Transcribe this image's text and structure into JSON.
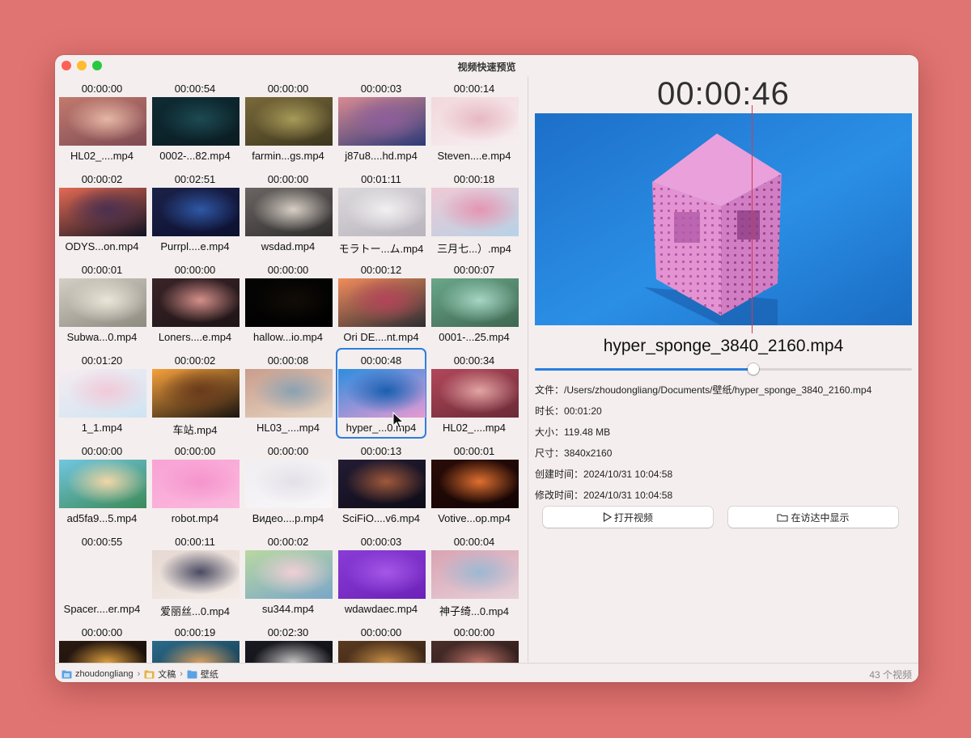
{
  "window": {
    "title": "视频快速预览"
  },
  "videos": [
    {
      "time": "00:00:00",
      "name": "HL02_....mp4",
      "thumb": [
        "#c27a6e",
        "#e6b7a5",
        "#7d4a52"
      ]
    },
    {
      "time": "00:00:54",
      "name": "0002-...82.mp4",
      "thumb": [
        "#0f2b34",
        "#1d4a52",
        "#0a1c22"
      ]
    },
    {
      "time": "00:00:00",
      "name": "farmin...gs.mp4",
      "thumb": [
        "#7a6a3a",
        "#a89a58",
        "#3d361e"
      ]
    },
    {
      "time": "00:00:03",
      "name": "j87u8....hd.mp4",
      "thumb": [
        "#d98a92",
        "#8d5e9c",
        "#2c3a78"
      ]
    },
    {
      "time": "00:00:14",
      "name": "Steven....e.mp4",
      "thumb": [
        "#f2d8dd",
        "#e7b8c2",
        "#f7eef0"
      ]
    },
    {
      "time": "00:00:02",
      "name": "ODYS...on.mp4",
      "thumb": [
        "#e36a54",
        "#4a3050",
        "#101322"
      ]
    },
    {
      "time": "00:02:51",
      "name": "Purrpl....e.mp4",
      "thumb": [
        "#1b2148",
        "#2f58a6",
        "#0c1030"
      ]
    },
    {
      "time": "00:00:00",
      "name": "wsdad.mp4",
      "thumb": [
        "#6b6664",
        "#d8d0c6",
        "#2e2c2c"
      ]
    },
    {
      "time": "00:01:11",
      "name": "モラトー...ム.mp4",
      "thumb": [
        "#dbd8dc",
        "#f3f0f2",
        "#b9b4bd"
      ]
    },
    {
      "time": "00:00:18",
      "name": "三月七...）.mp4",
      "thumb": [
        "#f0c9d4",
        "#e595b1",
        "#b6d2e6"
      ]
    },
    {
      "time": "00:00:01",
      "name": "Subwa...0.mp4",
      "thumb": [
        "#d3cfc4",
        "#ebe6d9",
        "#8d8a80"
      ]
    },
    {
      "time": "00:00:00",
      "name": "Loners....e.mp4",
      "thumb": [
        "#3a2428",
        "#d5908a",
        "#1e1416"
      ]
    },
    {
      "time": "00:00:00",
      "name": "hallow...io.mp4",
      "thumb": [
        "#050505",
        "#120c06",
        "#000000"
      ]
    },
    {
      "time": "00:00:12",
      "name": "Ori DE....nt.mp4",
      "thumb": [
        "#f28c5c",
        "#b3435a",
        "#2c2d33"
      ]
    },
    {
      "time": "00:00:07",
      "name": "0001-...25.mp4",
      "thumb": [
        "#6aa78a",
        "#a6d6c4",
        "#3e6650"
      ]
    },
    {
      "time": "00:01:20",
      "name": "1_1.mp4",
      "thumb": [
        "#f6ecf1",
        "#f2c9d8",
        "#cfe4f2"
      ]
    },
    {
      "time": "00:00:02",
      "name": "车站.mp4",
      "thumb": [
        "#f6a13c",
        "#6a3a1c",
        "#1a1410"
      ]
    },
    {
      "time": "00:00:08",
      "name": "HL03_....mp4",
      "thumb": [
        "#c99d8c",
        "#8aa1b2",
        "#e7d6c4"
      ]
    },
    {
      "time": "00:00:48",
      "name": "hyper_...0.mp4",
      "thumb": [
        "#2c8de0",
        "#1a5fb0",
        "#e89ad2"
      ]
    },
    {
      "time": "00:00:34",
      "name": "HL02_....mp4",
      "thumb": [
        "#b2475a",
        "#e2a4a4",
        "#6a2a36"
      ]
    },
    {
      "time": "00:00:00",
      "name": "ad5fa9...5.mp4",
      "thumb": [
        "#71c6e0",
        "#f2d6a6",
        "#3b8a58"
      ]
    },
    {
      "time": "00:00:00",
      "name": "robot.mp4",
      "thumb": [
        "#f8a3d4",
        "#f594cd",
        "#fbb8dd"
      ]
    },
    {
      "time": "00:00:00",
      "name": "Видео....p.mp4",
      "thumb": [
        "#f1eef2",
        "#e4e0e8",
        "#f8f6f9"
      ]
    },
    {
      "time": "00:00:13",
      "name": "SciFiO....v6.mp4",
      "thumb": [
        "#231c34",
        "#a0593a",
        "#0e0c18"
      ]
    },
    {
      "time": "00:00:01",
      "name": "Votive...op.mp4",
      "thumb": [
        "#2a0c08",
        "#e07030",
        "#120403"
      ]
    },
    {
      "time": "00:00:55",
      "name": "Spacer....er.mp4",
      "thumb": [
        "#f4eeee",
        "#f4eeee",
        "#f4eeee"
      ]
    },
    {
      "time": "00:00:11",
      "name": "爱丽丝...0.mp4",
      "thumb": [
        "#e6d8d2",
        "#4a4a62",
        "#f4ece6"
      ]
    },
    {
      "time": "00:00:02",
      "name": "su344.mp4",
      "thumb": [
        "#b9d8a2",
        "#f0cfd6",
        "#7aa6c8"
      ]
    },
    {
      "time": "00:00:03",
      "name": "wdawdaec.mp4",
      "thumb": [
        "#8a3cd6",
        "#a557e8",
        "#6c22b8"
      ]
    },
    {
      "time": "00:00:04",
      "name": "神子绮...0.mp4",
      "thumb": [
        "#d9a3b3",
        "#9cb8d2",
        "#e6d0d8"
      ]
    },
    {
      "time": "00:00:00",
      "name": "",
      "thumb": [
        "#2a1a12",
        "#e0a040",
        "#100a06"
      ]
    },
    {
      "time": "00:00:19",
      "name": "",
      "thumb": [
        "#2a6a8a",
        "#d8a060",
        "#143040"
      ]
    },
    {
      "time": "00:02:30",
      "name": "",
      "thumb": [
        "#1a1a22",
        "#c8c8c8",
        "#0a0a10"
      ]
    },
    {
      "time": "00:00:00",
      "name": "",
      "thumb": [
        "#5a3a20",
        "#c89048",
        "#2a1a10"
      ]
    },
    {
      "time": "00:00:00",
      "name": "",
      "thumb": [
        "#4a2e2a",
        "#c0746a",
        "#241414"
      ]
    }
  ],
  "selected_index": 18,
  "preview": {
    "time": "00:00:46",
    "filename": "hyper_sponge_3840_2160.mp4",
    "progress_fraction": 0.58,
    "info": [
      {
        "label": "文件：",
        "value": "/Users/zhoudongliang/Documents/壁纸/hyper_sponge_3840_2160.mp4"
      },
      {
        "label": "时长：",
        "value": "00:01:20"
      },
      {
        "label": "大小：",
        "value": "119.48 MB"
      },
      {
        "label": "尺寸：",
        "value": "3840x2160"
      },
      {
        "label": "创建时间：",
        "value": "2024/10/31 10:04:58"
      },
      {
        "label": "修改时间：",
        "value": "2024/10/31 10:04:58"
      }
    ],
    "open_button": "打开视频",
    "finder_button": "在访达中显示"
  },
  "breadcrumb": [
    "zhoudongliang",
    "文稿",
    "壁纸"
  ],
  "status": {
    "count": "43 个视频"
  },
  "colors": {
    "accent": "#2b7ee0",
    "marker": "#d23c4f",
    "background": "#e07472"
  },
  "icons": [
    "play-icon",
    "folder-icon",
    "home-folder-icon",
    "documents-folder-icon",
    "cursor-icon"
  ]
}
